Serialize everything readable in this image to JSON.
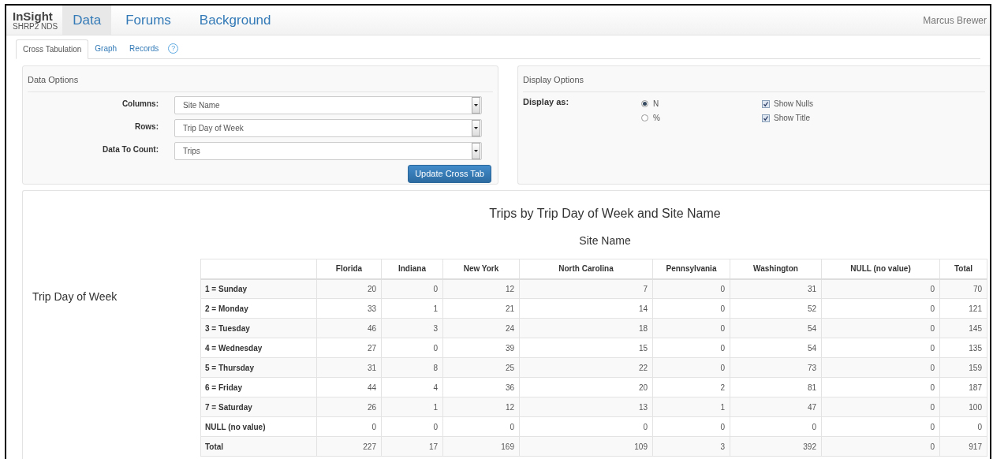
{
  "brand": {
    "title": "InSight",
    "subtitle": "SHRP2 NDS"
  },
  "nav": [
    {
      "label": "Data",
      "selected": true
    },
    {
      "label": "Forums",
      "selected": false
    },
    {
      "label": "Background",
      "selected": false
    }
  ],
  "user": "Marcus Brewer",
  "tabs": [
    {
      "label": "Cross Tabulation",
      "selected": true
    },
    {
      "label": "Graph",
      "selected": false
    },
    {
      "label": "Records",
      "selected": false
    }
  ],
  "help_icon": "?",
  "data_options": {
    "title": "Data Options",
    "fields": [
      {
        "label": "Columns:",
        "value": "Site Name"
      },
      {
        "label": "Rows:",
        "value": "Trip Day of Week"
      },
      {
        "label": "Data To Count:",
        "value": "Trips"
      }
    ],
    "button": "Update Cross Tab"
  },
  "display_options": {
    "title": "Display Options",
    "label": "Display as:",
    "radios": [
      {
        "label": "N",
        "selected": true
      },
      {
        "label": "%",
        "selected": false
      }
    ],
    "checkboxes": [
      {
        "label": "Show Nulls",
        "checked": true
      },
      {
        "label": "Show Title",
        "checked": true
      }
    ]
  },
  "crosstab": {
    "title": "Trips by Trip Day of Week and Site Name",
    "column_title": "Site Name",
    "row_title": "Trip Day of Week",
    "columns": [
      "Florida",
      "Indiana",
      "New York",
      "North Carolina",
      "Pennsylvania",
      "Washington",
      "NULL (no value)",
      "Total"
    ],
    "rows": [
      {
        "label": "1 = Sunday",
        "values": [
          "20",
          "0",
          "12",
          "7",
          "0",
          "31",
          "0",
          "70"
        ]
      },
      {
        "label": "2 = Monday",
        "values": [
          "33",
          "1",
          "21",
          "14",
          "0",
          "52",
          "0",
          "121"
        ]
      },
      {
        "label": "3 = Tuesday",
        "values": [
          "46",
          "3",
          "24",
          "18",
          "0",
          "54",
          "0",
          "145"
        ]
      },
      {
        "label": "4 = Wednesday",
        "values": [
          "27",
          "0",
          "39",
          "15",
          "0",
          "54",
          "0",
          "135"
        ]
      },
      {
        "label": "5 = Thursday",
        "values": [
          "31",
          "8",
          "25",
          "22",
          "0",
          "73",
          "0",
          "159"
        ]
      },
      {
        "label": "6 = Friday",
        "values": [
          "44",
          "4",
          "36",
          "20",
          "2",
          "81",
          "0",
          "187"
        ]
      },
      {
        "label": "7 = Saturday",
        "values": [
          "26",
          "1",
          "12",
          "13",
          "1",
          "47",
          "0",
          "100"
        ]
      },
      {
        "label": "NULL (no value)",
        "values": [
          "0",
          "0",
          "0",
          "0",
          "0",
          "0",
          "0",
          "0"
        ]
      },
      {
        "label": "Total",
        "values": [
          "227",
          "17",
          "169",
          "109",
          "3",
          "392",
          "0",
          "917"
        ]
      }
    ]
  }
}
